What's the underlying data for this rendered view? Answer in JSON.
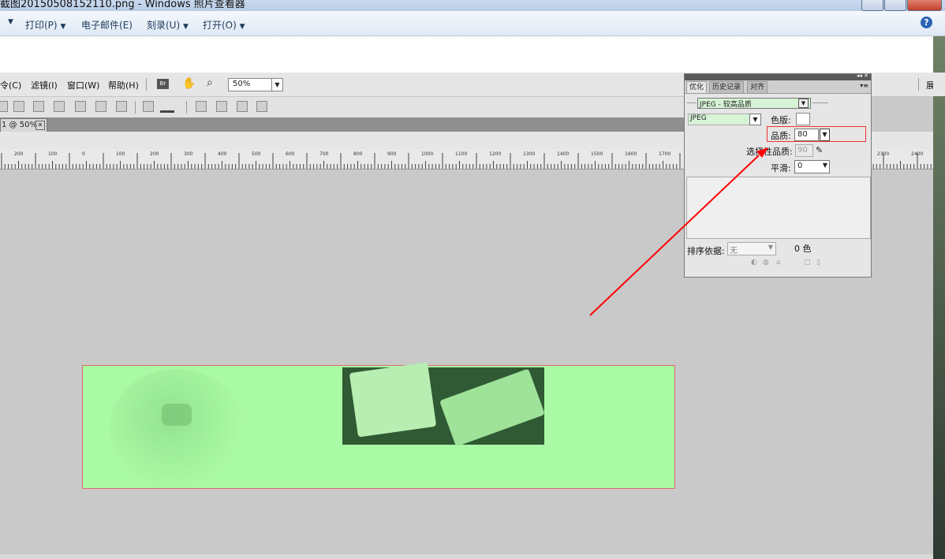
{
  "viewer": {
    "title": "截图20150508152110.png - Windows 照片查看器",
    "menu": [
      {
        "label": "打印(P)"
      },
      {
        "label": "电子邮件(E)"
      },
      {
        "label": "刻录(U)"
      },
      {
        "label": "打开(O)"
      }
    ],
    "help": "?"
  },
  "fireworks": {
    "menu": [
      "令(C)",
      "滤镜(I)",
      "窗口(W)",
      "帮助(H)"
    ],
    "br_label": "Br",
    "zoom": "50%",
    "right_menu_fragment": "展",
    "doc_tab": "1 @ 50%",
    "ruler_labels": [
      "200",
      "100",
      "0",
      "100",
      "200",
      "300",
      "400",
      "500",
      "600",
      "700",
      "800",
      "900",
      "1000",
      "1100",
      "1200",
      "1300",
      "1400",
      "1500",
      "1600",
      "1700",
      "2300",
      "2400"
    ]
  },
  "optimize_panel": {
    "tabs": [
      "优化",
      "历史记录",
      "对齐"
    ],
    "preset": "JPEG - 较高品质",
    "format": "JPEG",
    "palette_label": "色版:",
    "quality_label": "品质:",
    "quality_value": "80",
    "selective_quality_label": "选择性品质:",
    "selective_quality_value": "90",
    "smoothing_label": "平滑:",
    "smoothing_value": "0",
    "sort_label": "排序依据:",
    "sort_value": "无",
    "colors_count": "0 色"
  },
  "colors": {
    "slice_fill": "#aaf9a4",
    "slice_border": "#e06a6a",
    "annotation": "#ff0000"
  }
}
